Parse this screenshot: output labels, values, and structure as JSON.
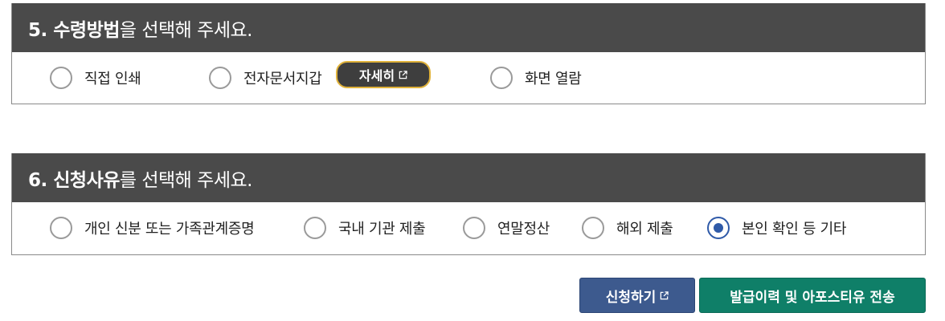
{
  "section5": {
    "title_strong": "5. 수령방법",
    "title_rest": "을 선택해 주세요.",
    "options": [
      {
        "label": "직접 인쇄",
        "checked": false
      },
      {
        "label": "전자문서지갑",
        "checked": false
      },
      {
        "label": "화면 열람",
        "checked": false
      }
    ],
    "detail_button": "자세히"
  },
  "section6": {
    "title_strong": "6. 신청사유",
    "title_rest": "를 선택해 주세요.",
    "options": [
      {
        "label": "개인 신분 또는 가족관계증명",
        "checked": false
      },
      {
        "label": "국내 기관 제출",
        "checked": false
      },
      {
        "label": "연말정산",
        "checked": false
      },
      {
        "label": "해외 제출",
        "checked": false
      },
      {
        "label": "본인 확인 등 기타",
        "checked": true
      }
    ]
  },
  "actions": {
    "apply": "신청하기",
    "history": "발급이력 및 아포스티유 전송"
  },
  "colors": {
    "header_bg": "#4a4a4a",
    "radio_checked": "#2f5aa8",
    "apply_bg": "#3d5a8e",
    "history_bg": "#0f7f68",
    "detail_border": "#e0b23a"
  },
  "icons": {
    "external_link": "external-link-icon"
  }
}
